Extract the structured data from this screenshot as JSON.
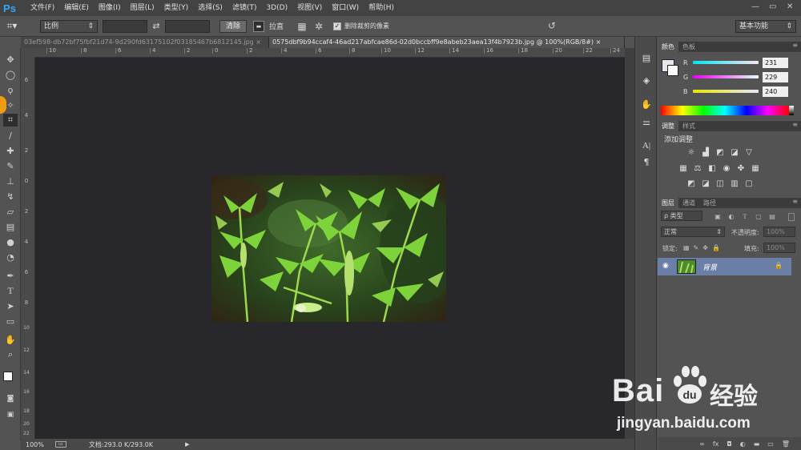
{
  "menu": {
    "logo": "Ps",
    "items": [
      "文件(F)",
      "编辑(E)",
      "图像(I)",
      "图层(L)",
      "类型(Y)",
      "选择(S)",
      "滤镜(T)",
      "3D(D)",
      "视图(V)",
      "窗口(W)",
      "帮助(H)"
    ]
  },
  "options": {
    "ratio": "比例",
    "clear": "清除",
    "straighten": "拉直",
    "delete_cropped": "删除裁剪的像素",
    "workspace": "基本功能"
  },
  "tabs": [
    {
      "title": "03ef598-db72bf75fbf21d74-9d290fd63175102f03185467b6812145.jpg",
      "active": false
    },
    {
      "title": "0575dbf9b94ccaf4-46ad217abfcae86d-02d0bccbff9e8abeb23aea13f4b7923b.jpg @ 100%(RGB/8#)",
      "active": true
    }
  ],
  "ruler_h": [
    "10",
    "8",
    "6",
    "4",
    "2",
    "0",
    "2",
    "4",
    "6",
    "8",
    "10",
    "12",
    "14",
    "16",
    "18",
    "20",
    "22",
    "24"
  ],
  "ruler_v": [
    "6",
    "4",
    "2",
    "0",
    "2",
    "4",
    "6",
    "8",
    "10",
    "12",
    "14",
    "16",
    "18",
    "20",
    "22"
  ],
  "status": {
    "zoom": "100%",
    "doc": "文档:293.0 K/293.0K"
  },
  "color_panel": {
    "tabs": [
      "颜色",
      "色板"
    ],
    "r": {
      "label": "R",
      "value": "231"
    },
    "g": {
      "label": "G",
      "value": "229"
    },
    "b": {
      "label": "B",
      "value": "240"
    }
  },
  "adjust_panel": {
    "tabs": [
      "调整",
      "样式"
    ],
    "title": "添加调整"
  },
  "layers_panel": {
    "tabs": [
      "图层",
      "通道",
      "路径"
    ],
    "kind": "ρ 类型",
    "blend": "正常",
    "opacity_label": "不透明度:",
    "opacity": "100%",
    "lock_label": "锁定:",
    "fill_label": "填充:",
    "fill": "100%",
    "layer_name": "背景"
  },
  "watermark": {
    "brand": "Bai",
    "brand2": "经验",
    "url": "jingyan.baidu.com"
  }
}
